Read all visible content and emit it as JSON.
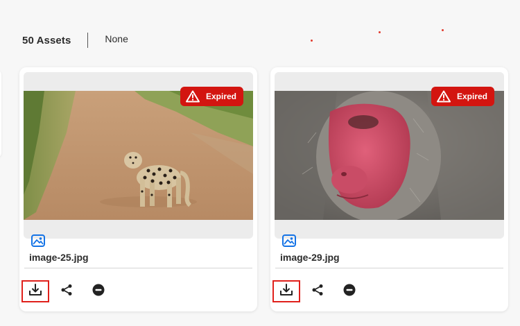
{
  "header": {
    "asset_count": "50 Assets",
    "selection": "None"
  },
  "assets": [
    {
      "file_name": "image-25.jpg",
      "badge": "Expired",
      "type_icon": "image-icon"
    },
    {
      "file_name": "image-29.jpg",
      "badge": "Expired",
      "type_icon": "image-icon"
    }
  ],
  "actions": {
    "download_icon": "download-icon",
    "share_icon": "share-icon",
    "remove_icon": "remove-icon"
  },
  "colors": {
    "badge": "#d31510",
    "highlight": "#e0201b",
    "type_icon": "#1473e6"
  }
}
